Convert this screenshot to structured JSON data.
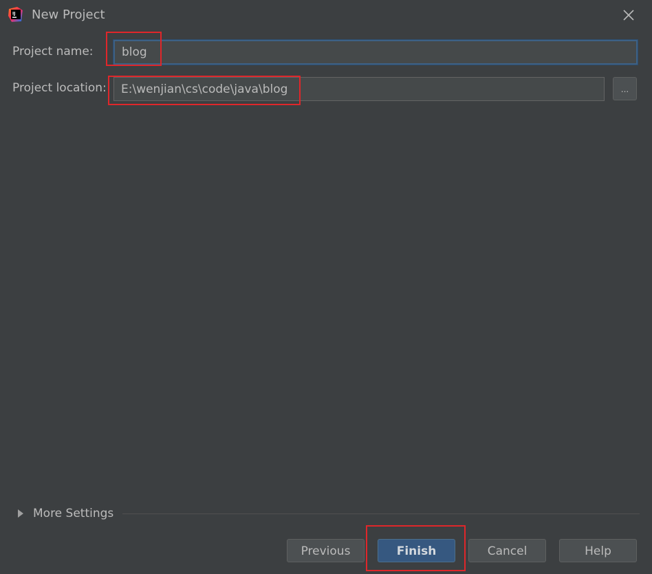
{
  "window": {
    "title": "New Project",
    "app_icon": "intellij-idea-icon",
    "close_icon": "close-icon"
  },
  "form": {
    "project_name_label": "Project name:",
    "project_name_value": "blog",
    "project_location_label": "Project location:",
    "project_location_value": "E:\\wenjian\\cs\\code\\java\\blog",
    "browse_label": "..."
  },
  "more_settings": {
    "label": "More Settings",
    "expanded": false
  },
  "buttons": {
    "previous": "Previous",
    "finish": "Finish",
    "cancel": "Cancel",
    "help": "Help"
  },
  "colors": {
    "background": "#3c3f41",
    "field_background": "#45494a",
    "primary_button": "#365880",
    "focus_border": "#3d6185",
    "highlight_annotation": "#e0262a"
  }
}
